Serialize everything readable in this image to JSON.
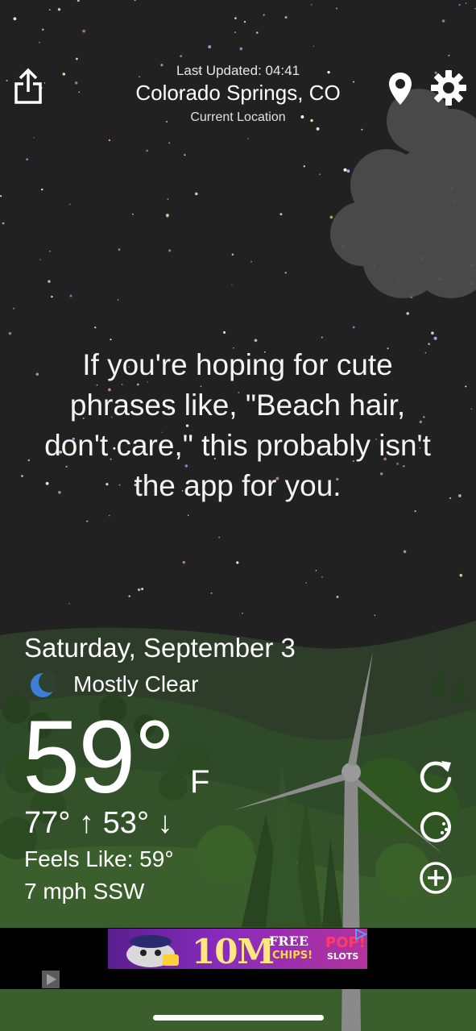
{
  "header": {
    "last_updated": "Last Updated: 04:41",
    "city": "Colorado Springs, CO",
    "location_label": "Current Location",
    "icons": [
      "share-icon",
      "location-pin-icon",
      "gear-icon"
    ]
  },
  "phrase": "If you're hoping for cute phrases like, \"Beach hair, don't care,\" this probably isn't the app for you.",
  "weather": {
    "date": "Saturday, September 3",
    "condition": "Mostly Clear",
    "condition_icon": "moon-icon",
    "temperature": "59°",
    "unit": "F",
    "high_low": "77° ↑  53° ↓",
    "feels_like": "Feels Like: 59°",
    "wind": "7 mph SSW"
  },
  "actions": {
    "icons": [
      "refresh-icon",
      "radar-icon",
      "add-icon"
    ]
  },
  "ad": {
    "headline": "10M",
    "sub1": "FREE",
    "sub2": "CHIPS!",
    "brand1": "POP!",
    "brand2": "SLOTS"
  },
  "colors": {
    "sky": "#212121",
    "hills": "#2e4a27",
    "accent_moon": "#3d7fd6",
    "ad_background": "#000000"
  }
}
